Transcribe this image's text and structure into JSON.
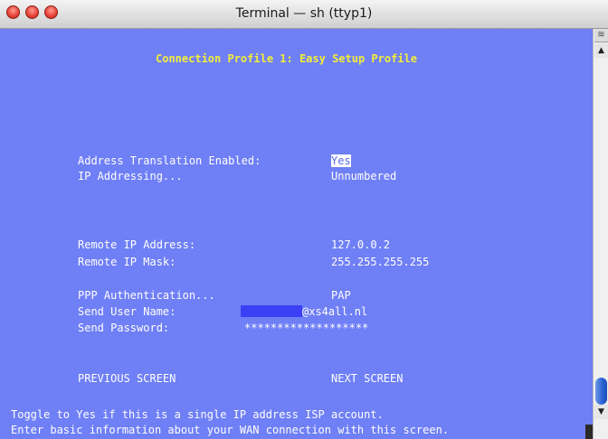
{
  "window": {
    "title": "Terminal — sh (ttyp1)"
  },
  "screen": {
    "heading": "Connection Profile 1: Easy Setup Profile",
    "fields": {
      "address_translation": {
        "label": "Address Translation Enabled:",
        "value": "Yes"
      },
      "ip_addressing": {
        "label": "IP Addressing...",
        "value": "Unnumbered"
      },
      "remote_ip_address": {
        "label": "Remote IP Address:",
        "value": "127.0.0.2"
      },
      "remote_ip_mask": {
        "label": "Remote IP Mask:",
        "value": "255.255.255.255"
      },
      "ppp_auth": {
        "label": "PPP Authentication...",
        "value": "PAP"
      },
      "send_user_name": {
        "label": "Send User Name:",
        "value": "@xs4all.nl"
      },
      "send_password": {
        "label": "Send Password:",
        "value": "*******************"
      }
    },
    "nav": {
      "previous": "PREVIOUS SCREEN",
      "next": "NEXT SCREEN"
    },
    "status": {
      "line1": "Toggle to Yes if this is a single IP address ISP account.",
      "line2": "Enter basic information about your WAN connection with this screen."
    }
  },
  "colors": {
    "terminal_bg": "#6f7ff5",
    "heading": "#f2ee3a",
    "mask": "#3b40f4"
  },
  "icons": {
    "close": "close-button-icon",
    "minimize": "minimize-button-icon",
    "zoom": "zoom-button-icon"
  }
}
